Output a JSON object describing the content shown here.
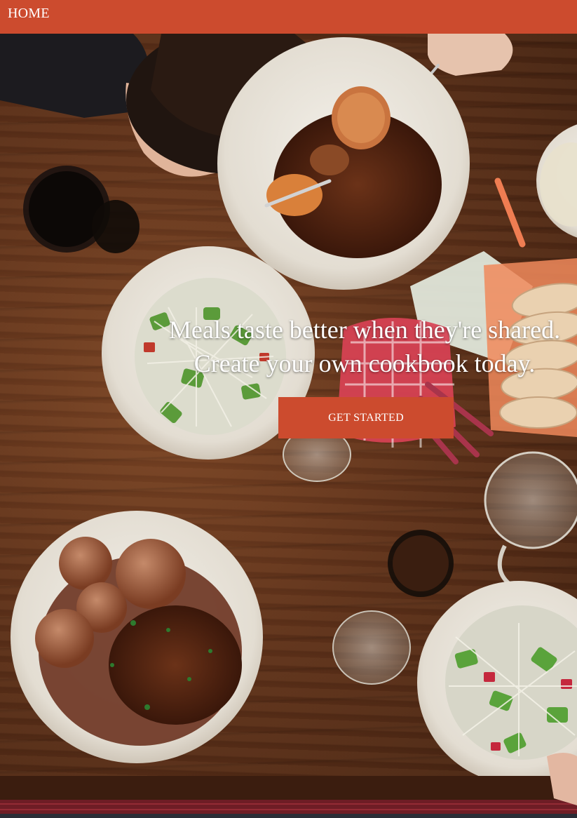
{
  "nav": {
    "home_label": "HOME"
  },
  "hero": {
    "headline_line1": "Meals taste better when they're shared.",
    "headline_line2": "Create your own cookbook today.",
    "cta_label": "GET STARTED"
  },
  "colors": {
    "accent": "#cc4b2e",
    "text_on_accent": "#ffffff"
  }
}
